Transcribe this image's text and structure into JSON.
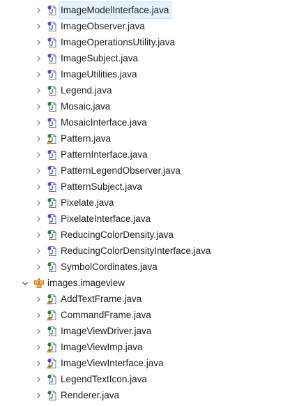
{
  "tree": {
    "before_files": [
      {
        "name": "ImageModelInterface.java",
        "kind": "interface",
        "selected": true
      },
      {
        "name": "ImageObserver.java",
        "kind": "interface"
      },
      {
        "name": "ImageOperationsUtility.java",
        "kind": "interface"
      },
      {
        "name": "ImageSubject.java",
        "kind": "interface"
      },
      {
        "name": "ImageUtilities.java",
        "kind": "interface"
      },
      {
        "name": "Legend.java",
        "kind": "class"
      },
      {
        "name": "Mosaic.java",
        "kind": "class"
      },
      {
        "name": "MosaicInterface.java",
        "kind": "interface"
      },
      {
        "name": "Pattern.java",
        "kind": "class-warning"
      },
      {
        "name": "PatternInterface.java",
        "kind": "interface"
      },
      {
        "name": "PatternLegendObserver.java",
        "kind": "interface"
      },
      {
        "name": "PatternSubject.java",
        "kind": "interface"
      },
      {
        "name": "Pixelate.java",
        "kind": "class"
      },
      {
        "name": "PixelateInterface.java",
        "kind": "interface"
      },
      {
        "name": "ReducingColorDensity.java",
        "kind": "class"
      },
      {
        "name": "ReducingColorDensityInterface.java",
        "kind": "interface"
      },
      {
        "name": "SymbolCordinates.java",
        "kind": "class"
      }
    ],
    "package": {
      "name": "images.imageview",
      "expanded": true
    },
    "after_files": [
      {
        "name": "AddTextFrame.java",
        "kind": "class-warning"
      },
      {
        "name": "CommandFrame.java",
        "kind": "class-warning"
      },
      {
        "name": "ImageViewDriver.java",
        "kind": "class"
      },
      {
        "name": "ImageViewImp.java",
        "kind": "class-warning"
      },
      {
        "name": "ImageViewInterface.java",
        "kind": "interface-warning"
      },
      {
        "name": "LegendTextIcon.java",
        "kind": "class"
      },
      {
        "name": "Renderer.java",
        "kind": "class"
      }
    ]
  },
  "colors": {
    "selection_bg": "#e5f1fb",
    "interface_icon": "#6a3fb8",
    "class_icon": "#2f7d32",
    "java_file": "#5f7f9f",
    "warning": "#e8a317",
    "package": "#c47a1e"
  },
  "icons": {
    "collapsed": "chevron-right-icon",
    "expanded": "chevron-down-icon",
    "java_file": "java-file-icon",
    "package": "package-icon"
  }
}
